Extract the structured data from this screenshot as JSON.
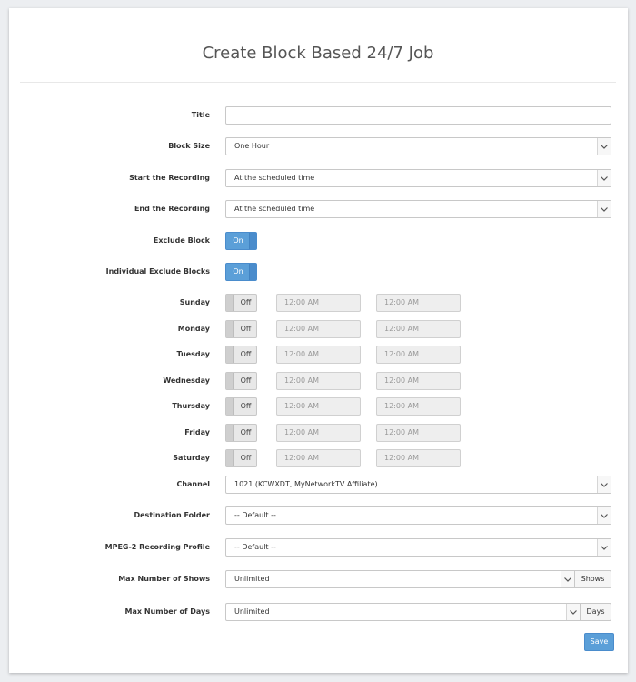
{
  "page": {
    "title": "Create Block Based 24/7 Job"
  },
  "form": {
    "title_label": "Title",
    "title_value": "",
    "block_size_label": "Block Size",
    "block_size_value": "One Hour",
    "start_label": "Start the Recording",
    "start_value": "At the scheduled time",
    "end_label": "End the Recording",
    "end_value": "At the scheduled time",
    "exclude_block_label": "Exclude Block",
    "exclude_block_state": "On",
    "individual_label": "Individual Exclude Blocks",
    "individual_state": "On",
    "days": [
      {
        "label": "Sunday",
        "state": "Off",
        "start": "12:00 AM",
        "end": "12:00 AM"
      },
      {
        "label": "Monday",
        "state": "Off",
        "start": "12:00 AM",
        "end": "12:00 AM"
      },
      {
        "label": "Tuesday",
        "state": "Off",
        "start": "12:00 AM",
        "end": "12:00 AM"
      },
      {
        "label": "Wednesday",
        "state": "Off",
        "start": "12:00 AM",
        "end": "12:00 AM"
      },
      {
        "label": "Thursday",
        "state": "Off",
        "start": "12:00 AM",
        "end": "12:00 AM"
      },
      {
        "label": "Friday",
        "state": "Off",
        "start": "12:00 AM",
        "end": "12:00 AM"
      },
      {
        "label": "Saturday",
        "state": "Off",
        "start": "12:00 AM",
        "end": "12:00 AM"
      }
    ],
    "channel_label": "Channel",
    "channel_value": "1021 (KCWXDT, MyNetworkTV Affiliate)",
    "dest_label": "Destination Folder",
    "dest_value": "-- Default --",
    "profile_label": "MPEG-2 Recording Profile",
    "profile_value": "-- Default --",
    "max_shows_label": "Max Number of Shows",
    "max_shows_value": "Unlimited",
    "max_shows_addon": "Shows",
    "max_days_label": "Max Number of Days",
    "max_days_value": "Unlimited",
    "max_days_addon": "Days",
    "save_label": "Save"
  },
  "icons": {
    "caret": "chevron-down-icon"
  },
  "colors": {
    "accent": "#5b9fd8",
    "background": "#eceef1"
  }
}
